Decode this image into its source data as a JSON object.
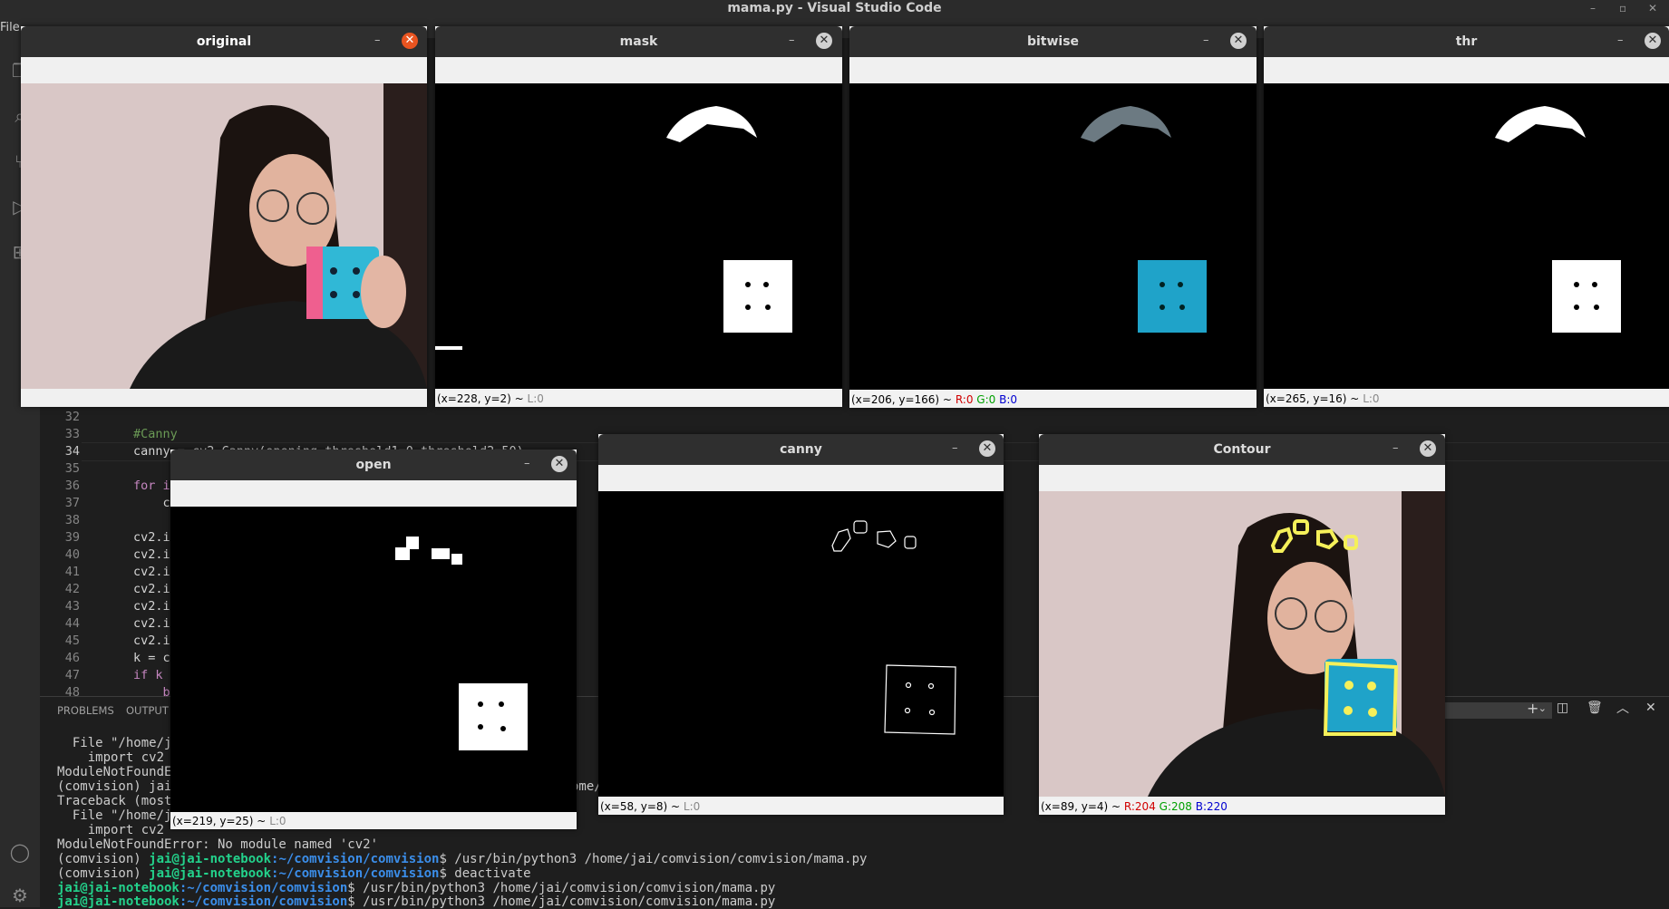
{
  "window_title": "mama.py - Visual Studio Code",
  "menu_first": "File",
  "editor": {
    "lines": [
      {
        "n": "32",
        "text": ""
      },
      {
        "n": "33",
        "text": "#Canny"
      },
      {
        "n": "34",
        "text": "canny = cv2.Canny(opening,threshold1=0,threshold2=50)"
      },
      {
        "n": "35",
        "text": ""
      },
      {
        "n": "36",
        "text": "for i"
      },
      {
        "n": "37",
        "text": "    c"
      },
      {
        "n": "38",
        "text": ""
      },
      {
        "n": "39",
        "text": "cv2.i"
      },
      {
        "n": "40",
        "text": "cv2.i"
      },
      {
        "n": "41",
        "text": "cv2.i"
      },
      {
        "n": "42",
        "text": "cv2.i"
      },
      {
        "n": "43",
        "text": "cv2.i"
      },
      {
        "n": "44",
        "text": "cv2.i"
      },
      {
        "n": "45",
        "text": "cv2.i"
      },
      {
        "n": "46",
        "text": "k = c"
      },
      {
        "n": "47",
        "text": "if k"
      },
      {
        "n": "48",
        "text": "    b"
      }
    ]
  },
  "panel": {
    "tabs": [
      "PROBLEMS",
      "OUTPUT"
    ],
    "terminal": [
      {
        "text": "  File \"/home/ja"
      },
      {
        "text": "    import cv2"
      },
      {
        "text": "ModuleNotFoundEr"
      },
      {
        "text": "(comvision) jai@"
      },
      {
        "text": "Traceback (most"
      },
      {
        "text": "  File \"/home/ja"
      },
      {
        "text": "    import cv2"
      },
      {
        "text": "ModuleNotFoundError: No module named 'cv2'"
      }
    ],
    "prompts": [
      {
        "env": "(comvision) ",
        "user": "jai@jai-notebook",
        "path": ":~/comvision/comvision",
        "cmd": "$ /usr/bin/python3 /home/jai/comvision/comvision/mama.py"
      },
      {
        "env": "(comvision) ",
        "user": "jai@jai-notebook",
        "path": ":~/comvision/comvision",
        "cmd": "$ deactivate"
      },
      {
        "env": "",
        "user": "jai@jai-notebook",
        "path": ":~/comvision/comvision",
        "cmd": "$ /usr/bin/python3 /home/jai/comvision/comvision/mama.py"
      },
      {
        "env": "",
        "user": "jai@jai-notebook",
        "path": ":~/comvision/comvision",
        "cmd": "$ /usr/bin/python3 /home/jai/comvision/comvision/mama.py"
      }
    ],
    "partial_text": "ome/"
  },
  "windows": {
    "original": {
      "title": "original"
    },
    "mask": {
      "title": "mask",
      "status_xy": "(x=228, y=2) ~",
      "status_l": "L:0"
    },
    "bitwise": {
      "title": "bitwise",
      "status_xy": "(x=206, y=166) ~",
      "r": "R:0",
      "g": "G:0",
      "b": "B:0"
    },
    "thr": {
      "title": "thr",
      "status_xy": "(x=265, y=16) ~",
      "status_l": "L:0"
    },
    "open": {
      "title": "open",
      "status_xy": "(x=219, y=25) ~",
      "status_l": "L:0"
    },
    "canny": {
      "title": "canny",
      "status_xy": "(x=58, y=8) ~",
      "status_l": "L:0"
    },
    "contour": {
      "title": "Contour",
      "status_xy": "(x=89, y=4) ~",
      "r": "R:204",
      "g": "G:208",
      "b": "B:220"
    }
  },
  "colors": {
    "contour_yellow": "#f5f05a",
    "cube_cyan": "#1fa3c9",
    "close_active": "#e95420"
  }
}
